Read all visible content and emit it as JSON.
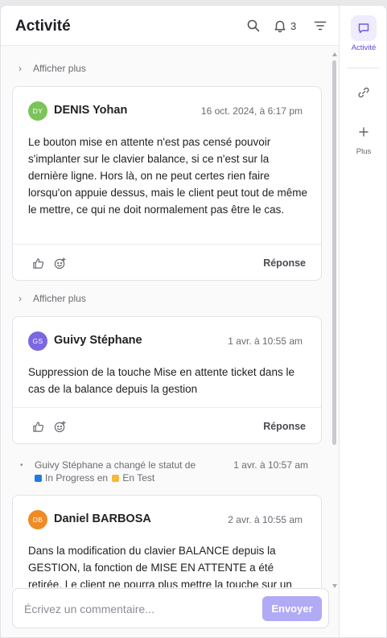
{
  "header": {
    "title": "Activité",
    "notification_count": "3",
    "icons": [
      "search-icon",
      "bell-icon",
      "filter-icon"
    ]
  },
  "feed": {
    "show_more_label": "Afficher plus",
    "reply_label": "Réponse",
    "comments": [
      {
        "initials": "DY",
        "avatar_color": "#7cc35a",
        "author": "DENIS Yohan",
        "date": "16 oct. 2024, à 6:17 pm",
        "text": "Le bouton mise en attente n'est pas censé pouvoir s'implanter sur le clavier balance, si ce n'est sur la dernière ligne. Hors là, on ne peut certes rien faire lorsqu'on appuie dessus, mais le client peut tout de même le mettre, ce qui ne doit normalement pas être le cas."
      },
      {
        "initials": "GS",
        "avatar_color": "#7b67e0",
        "author": "Guivy Stéphane",
        "date": "1 avr. à 10:55 am",
        "text": "Suppression de la touche Mise en attente ticket dans le cas de la balance depuis la gestion"
      },
      {
        "initials": "DB",
        "avatar_color": "#f08a24",
        "author": "Daniel BARBOSA",
        "date": "2 avr. à 10:55 am",
        "text": "Dans la modification du clavier BALANCE depuis la GESTION, la fonction de MISE EN ATTENTE a été retirée. Le client ne pourra plus mettre la touche sur un clavier"
      }
    ],
    "status_change": {
      "text": "Guivy Stéphane a changé le statut de",
      "from_label": "In Progress",
      "from_color": "#1e7be0",
      "connector": "en",
      "to_label": "En Test",
      "to_color": "#f5b83d",
      "time": "1 avr. à 10:57 am"
    }
  },
  "composer": {
    "placeholder": "Écrivez un commentaire...",
    "send_label": "Envoyer"
  },
  "sidebar": {
    "items": [
      {
        "label": "Activité",
        "icon": "comment-icon",
        "active": true
      },
      {
        "label": "",
        "icon": "link-icon",
        "active": false
      },
      {
        "label": "Plus",
        "icon": "plus-icon",
        "active": false
      }
    ]
  }
}
